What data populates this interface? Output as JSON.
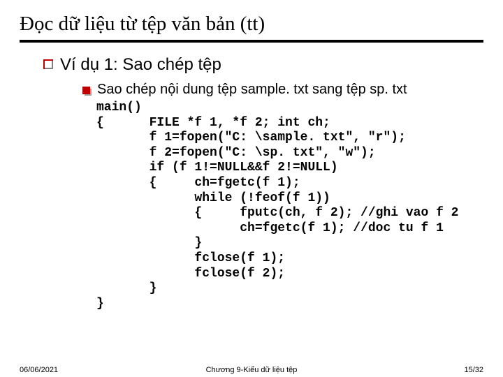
{
  "title": "Đọc dữ liệu từ tệp văn bản (tt)",
  "lvl1_text": "Ví dụ 1: Sao chép tệp",
  "lvl2_text": "Sao chép nội dung tệp sample. txt sang tệp sp. txt",
  "code": "main()\n{      FILE *f 1, *f 2; int ch;\n       f 1=fopen(\"C: \\sample. txt\", \"r\");\n       f 2=fopen(\"C: \\sp. txt\", \"w\");\n       if (f 1!=NULL&&f 2!=NULL)\n       {     ch=fgetc(f 1);\n             while (!feof(f 1))\n             {     fputc(ch, f 2); //ghi vao f 2\n                   ch=fgetc(f 1); //doc tu f 1\n             }\n             fclose(f 1);\n             fclose(f 2);\n       }\n}",
  "footer": {
    "date": "06/06/2021",
    "center": "Chương 9-Kiểu dữ liệu tệp",
    "page": "15/32"
  }
}
